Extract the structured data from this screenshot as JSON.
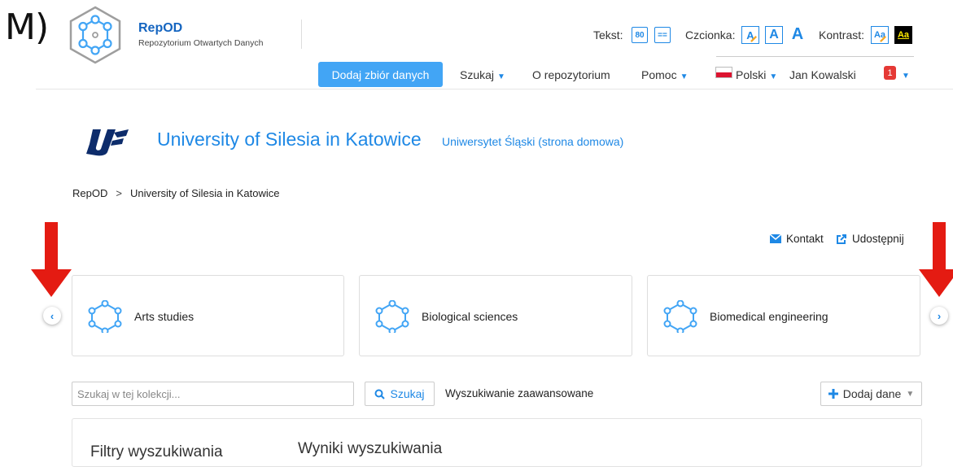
{
  "panel_label": "M)",
  "brand": {
    "name": "RepOD",
    "subtitle": "Repozytorium Otwartych Danych"
  },
  "toolbar": {
    "text_label": "Tekst:",
    "text_size_value": "80",
    "text_spacing_glyph": "==",
    "font_label": "Czcionka:",
    "font_buttons": [
      "A",
      "A",
      "A"
    ],
    "contrast_label": "Kontrast:",
    "contrast_buttons": [
      "Aa",
      "Aa"
    ]
  },
  "nav": {
    "add_dataset": "Dodaj zbiór danych",
    "search": "Szukaj",
    "about": "O repozytorium",
    "help": "Pomoc",
    "language": "Polski",
    "user": "Jan Kowalski",
    "notifications_count": "1"
  },
  "institution": {
    "name": "University of Silesia in Katowice",
    "homepage_link": "Uniwersytet Śląski (strona domowa)"
  },
  "breadcrumb": {
    "root": "RepOD",
    "separator": ">",
    "current": "University of Silesia in Katowice"
  },
  "actions": {
    "contact": "Kontakt",
    "share": "Udostępnij"
  },
  "carousel": {
    "items": [
      "Arts studies",
      "Biological sciences",
      "Biomedical engineering"
    ]
  },
  "search": {
    "placeholder": "Szukaj w tej kolekcji...",
    "button": "Szukaj",
    "advanced": "Wyszukiwanie zaawansowane",
    "add_data": "Dodaj dane"
  },
  "results": {
    "filters_title": "Filtry wyszukiwania",
    "results_title": "Wyniki wyszukiwania"
  },
  "colors": {
    "accent": "#1e88e5",
    "primary_button": "#42a5f5",
    "annotation_arrow": "#e41b12",
    "badge": "#e53935"
  }
}
